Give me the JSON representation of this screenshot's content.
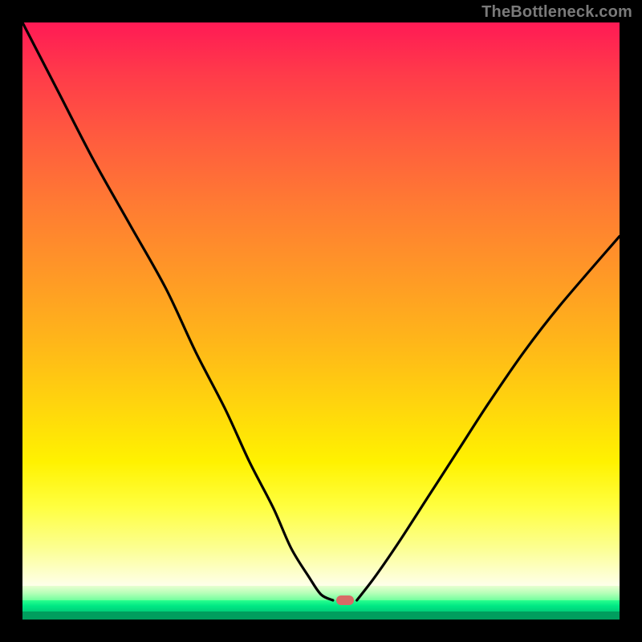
{
  "watermark": "TheBottleneck.com",
  "chart_data": {
    "type": "line",
    "title": "",
    "xlabel": "",
    "ylabel": "",
    "xlim": [
      0,
      100
    ],
    "ylim": [
      0,
      100
    ],
    "grid": false,
    "legend": false,
    "series": [
      {
        "name": "bottleneck-curve-left",
        "x": [
          0,
          6,
          12,
          18,
          24,
          29,
          34,
          38,
          42,
          45,
          48,
          50,
          52
        ],
        "values": [
          100,
          88,
          76,
          65,
          54,
          43,
          33,
          24,
          16,
          9,
          4,
          1,
          0
        ]
      },
      {
        "name": "bottleneck-curve-right",
        "x": [
          56,
          59,
          63,
          68,
          73,
          78,
          84,
          90,
          100
        ],
        "values": [
          0,
          4,
          10,
          18,
          26,
          34,
          43,
          51,
          63
        ]
      }
    ],
    "optimal_marker": {
      "x": 54,
      "y": 0
    },
    "background_gradient": {
      "top_color": "#ff1a55",
      "mid_color": "#fff200",
      "low_band_color": "#feffea",
      "green_band_color": "#00e884",
      "bottom_line_color": "#009e5e"
    }
  }
}
